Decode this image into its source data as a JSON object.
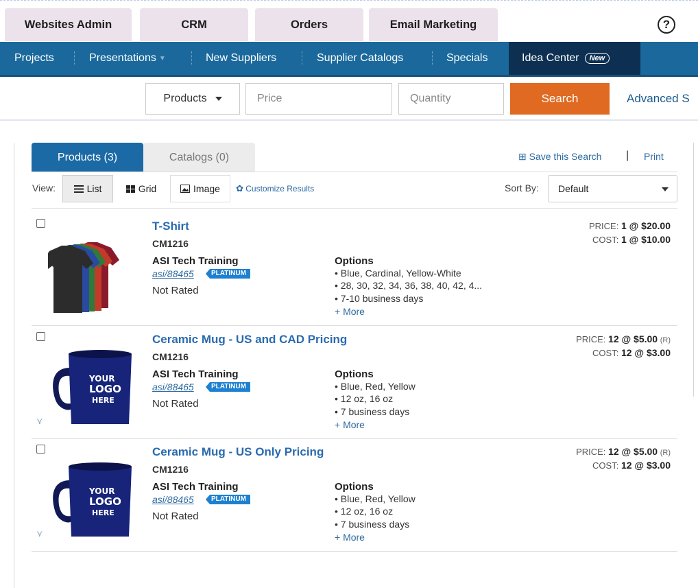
{
  "app_tabs": [
    "Websites Admin",
    "CRM",
    "Orders",
    "Email Marketing"
  ],
  "help_label": "?",
  "nav": {
    "items": [
      "Projects",
      "Presentations",
      "New Suppliers",
      "Supplier Catalogs",
      "Specials",
      "Idea Center"
    ],
    "new_badge": "New"
  },
  "search": {
    "category": "Products",
    "price_placeholder": "Price",
    "quantity_placeholder": "Quantity",
    "button": "Search",
    "advanced": "Advanced S"
  },
  "results": {
    "tab_products": "Products (3)",
    "tab_catalogs": "Catalogs (0)",
    "save_search": "⊞ Save this Search",
    "separator": "|",
    "print": "Print",
    "view_label": "View:",
    "view_list": "List",
    "view_grid": "Grid",
    "view_image": "Image",
    "customize": "Customize Results",
    "sort_label": "Sort By:",
    "sort_value": "Default"
  },
  "products": [
    {
      "name": "T-Shirt",
      "code": "CM1216",
      "supplier": "ASI Tech Training",
      "asi": "asi/88465",
      "badge": "PLATINUM",
      "rating": "Not Rated",
      "options_label": "Options",
      "options": [
        "Blue, Cardinal, Yellow-White",
        "28, 30, 32, 34, 36, 38, 40, 42, 4...",
        "7-10 business days"
      ],
      "more": "+ More",
      "price_label": "PRICE:",
      "price_value": "1 @ $20.00",
      "price_note": "",
      "cost_label": "COST:",
      "cost_value": "1 @ $10.00"
    },
    {
      "name": "Ceramic Mug - US and CAD Pricing",
      "code": "CM1216",
      "supplier": "ASI Tech Training",
      "asi": "asi/88465",
      "badge": "PLATINUM",
      "rating": "Not Rated",
      "options_label": "Options",
      "options": [
        "Blue, Red, Yellow",
        "12 oz, 16 oz",
        "7 business days"
      ],
      "more": "+ More",
      "price_label": "PRICE:",
      "price_value": "12 @ $5.00",
      "price_note": "(R)",
      "cost_label": "COST:",
      "cost_value": "12 @ $3.00"
    },
    {
      "name": "Ceramic Mug - US Only Pricing",
      "code": "CM1216",
      "supplier": "ASI Tech Training",
      "asi": "asi/88465",
      "badge": "PLATINUM",
      "rating": "Not Rated",
      "options_label": "Options",
      "options": [
        "Blue, Red, Yellow",
        "12 oz, 16 oz",
        "7 business days"
      ],
      "more": "+ More",
      "price_label": "PRICE:",
      "price_value": "12 @ $5.00",
      "price_note": "(R)",
      "cost_label": "COST:",
      "cost_value": "12 @ $3.00"
    }
  ],
  "mug_logo": [
    "YOUR",
    "LOGO",
    "HERE"
  ],
  "colors": {
    "navbar": "#1b699c",
    "idea_center": "#0d3052",
    "search_button": "#e06a22",
    "active_tab": "#1b6aa5",
    "badge": "#1e80d0",
    "link": "#2a6bb0"
  }
}
